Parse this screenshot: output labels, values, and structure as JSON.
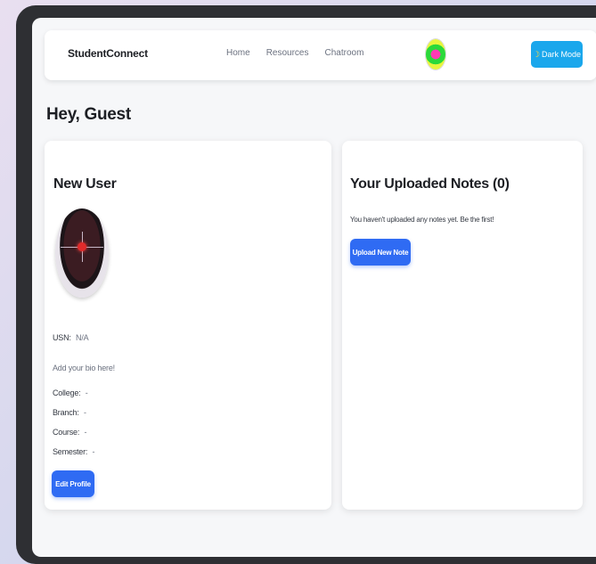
{
  "navbar": {
    "brand": "StudentConnect",
    "links": [
      "Home",
      "Resources",
      "Chatroom"
    ],
    "dark_mode_label": "Dark Mode",
    "dark_mode_icon": "moon-icon"
  },
  "greeting": "Hey, Guest",
  "profile": {
    "name": "New User",
    "usn_label": "USN:",
    "usn_value": "N/A",
    "bio": "Add your bio here!",
    "fields": [
      {
        "label": "College:",
        "value": "-"
      },
      {
        "label": "Branch:",
        "value": "-"
      },
      {
        "label": "Course:",
        "value": "-"
      },
      {
        "label": "Semester:",
        "value": "-"
      }
    ],
    "edit_label": "Edit Profile"
  },
  "notes": {
    "title": "Your Uploaded Notes (0)",
    "empty_text": "You haven't uploaded any notes yet. Be the first!",
    "upload_label": "Upload New Note"
  },
  "colors": {
    "accent_blue": "#2f6bf3",
    "dark_mode_button": "#1aa7ec"
  }
}
